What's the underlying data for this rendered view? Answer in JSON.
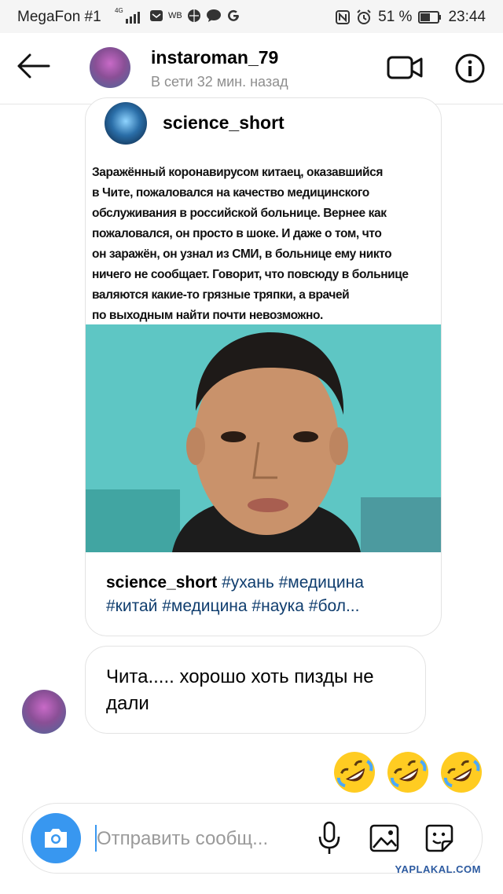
{
  "status_bar": {
    "carrier": "MegaFon #1",
    "network_badge": "4G",
    "app_badge": "WB",
    "battery": "51 %",
    "time": "23:44"
  },
  "header": {
    "username": "instaroman_79",
    "status": "В сети 32 мин. назад",
    "icons": [
      "back-arrow-icon",
      "video-call-icon",
      "info-icon"
    ]
  },
  "shared_post": {
    "account": "science_short",
    "text_lines": [
      "Заражённый коронавирусом китаец, оказавшийся",
      "в Чите, пожаловался на качество медицинского",
      "обслуживания в российской больнице. Вернее как",
      "пожаловался, он просто в шоке. И даже о том, что",
      "он заражён, он узнал из СМИ, в больнице ему никто",
      "ничего не сообщает. Говорит, что повсюду в больнице",
      "валяются какие-то грязные тряпки, а врачей",
      "по выходным найти почти невозможно."
    ],
    "caption_user": "science_short",
    "caption_line1": "#ухань #медицина",
    "caption_line2": "#китай #медицина #наука #бол..."
  },
  "message": {
    "text": "Чита..... хорошо хоть пизды не дали"
  },
  "reactions": [
    "rolling-on-floor-laughing-emoji",
    "rolling-on-floor-laughing-emoji",
    "rolling-on-floor-laughing-emoji"
  ],
  "composer": {
    "placeholder": "Отправить сообщ..."
  },
  "watermark": "YAPLAKAL.COM",
  "colors": {
    "accent": "#3897f0",
    "hashtag": "#0f3d6e",
    "secondary_text": "#8e8e8e"
  }
}
